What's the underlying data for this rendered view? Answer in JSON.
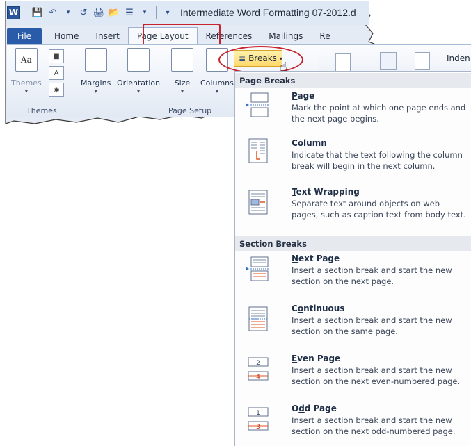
{
  "qat": {
    "title": "Intermediate Word Formatting 07-2012.d",
    "logo_letter": "W"
  },
  "tabs": {
    "file": "File",
    "home": "Home",
    "insert": "Insert",
    "page_layout": "Page Layout",
    "references": "References",
    "mailings": "Mailings",
    "partial": "Re"
  },
  "ribbon": {
    "themes_label": "Themes",
    "themes_group": "Themes",
    "margins": "Margins",
    "orientation": "Orientation",
    "size": "Size",
    "columns": "Columns",
    "page_setup_group": "Page Setup",
    "breaks": "Breaks",
    "indent_partial": "Inden"
  },
  "menu": {
    "page_breaks_header": "Page Breaks",
    "section_breaks_header": "Section Breaks",
    "page_breaks": [
      {
        "title_underline": "P",
        "title_rest": "age",
        "desc": "Mark the point at which one page ends and the next page begins."
      },
      {
        "title_underline": "C",
        "title_rest": "olumn",
        "desc": "Indicate that the text following the column break will begin in the next column."
      },
      {
        "title_underline": "T",
        "title_rest": "ext Wrapping",
        "desc": "Separate text around objects on web pages, such as caption text from body text."
      }
    ],
    "section_breaks": [
      {
        "title_underline": "N",
        "title_rest": "ext Page",
        "desc": "Insert a section break and start the new section on the next page."
      },
      {
        "title_prefix": "C",
        "title_underline": "o",
        "title_rest": "ntinuous",
        "desc": "Insert a section break and start the new section on the same page."
      },
      {
        "title_underline": "E",
        "title_rest": "ven Page",
        "desc": "Insert a section break and start the new section on the next even-numbered page."
      },
      {
        "title_prefix": "O",
        "title_underline": "d",
        "title_rest": "d Page",
        "desc": "Insert a section break and start the new section on the next odd-numbered page."
      }
    ],
    "even_page_thumb_numbers": [
      "2",
      "4"
    ],
    "odd_page_thumb_numbers": [
      "1",
      "3"
    ]
  },
  "colors": {
    "highlight_outline": "#c8232c",
    "file_tab": "#2a5ba8",
    "breaks_button": "#ffd86a"
  }
}
